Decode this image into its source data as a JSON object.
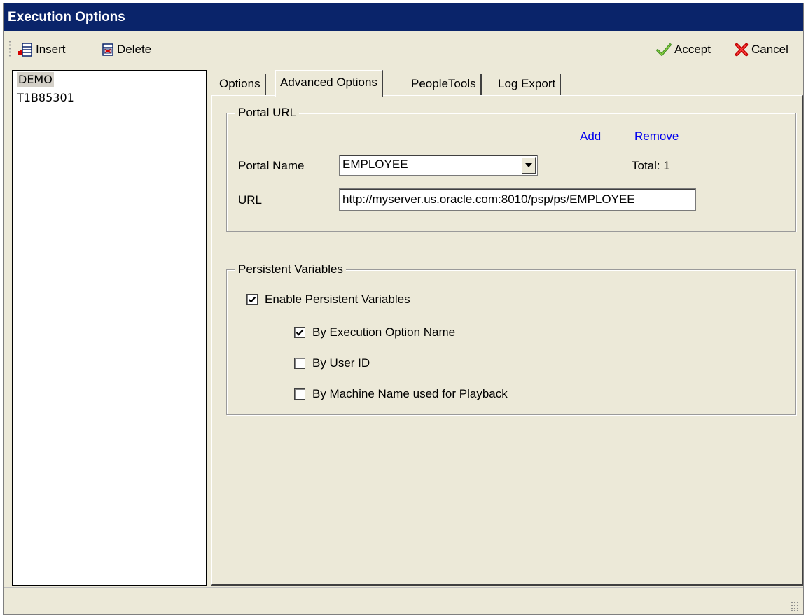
{
  "window": {
    "title": "Execution Options"
  },
  "toolbar": {
    "insert_label": "Insert",
    "delete_label": "Delete",
    "accept_label": "Accept",
    "cancel_label": "Cancel"
  },
  "list": {
    "items": [
      "DEMO",
      "T1B85301"
    ],
    "selected": "DEMO"
  },
  "tabs": [
    {
      "label": "Options"
    },
    {
      "label": "Advanced Options",
      "active": true
    },
    {
      "label": "PeopleTools"
    },
    {
      "label": "Log Export"
    }
  ],
  "portal_url": {
    "group_title": "Portal URL",
    "add_link": "Add",
    "remove_link": "Remove",
    "portal_name_label": "Portal Name",
    "portal_name_value": "EMPLOYEE",
    "total_text": "Total: 1",
    "url_label": "URL",
    "url_value": "http://myserver.us.oracle.com:8010/psp/ps/EMPLOYEE"
  },
  "persistent_variables": {
    "group_title": "Persistent Variables",
    "enable_label": "Enable Persistent Variables",
    "enable_checked": true,
    "by_execution_label": "By Execution Option Name",
    "by_execution_checked": true,
    "by_user_label": "By User ID",
    "by_user_checked": false,
    "by_machine_label": "By Machine Name used for Playback",
    "by_machine_checked": false
  },
  "icons": {
    "insert": "insert-row-icon",
    "delete": "delete-row-icon",
    "accept": "checkmark-icon",
    "cancel": "red-x-icon",
    "dropdown": "triangle-down-icon"
  }
}
